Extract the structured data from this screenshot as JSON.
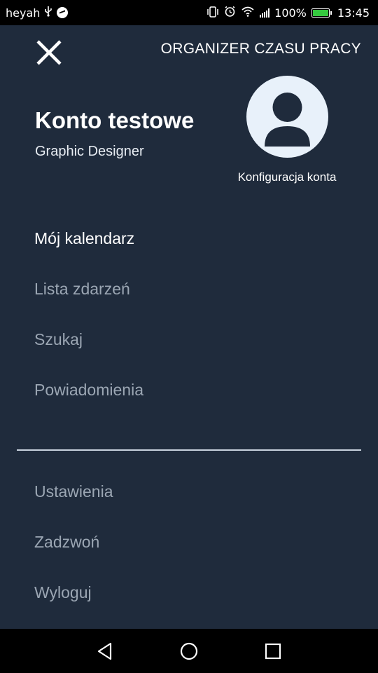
{
  "status_bar": {
    "carrier": "heyah",
    "battery_percent": "100%",
    "time": "13:45",
    "icons": [
      "usb-icon",
      "messenger-icon",
      "vibrate-icon",
      "alarm-icon",
      "wifi-icon",
      "signal-icon",
      "battery-icon"
    ]
  },
  "header": {
    "app_title": "ORGANIZER CZASU PRACY",
    "close_icon": "close-icon"
  },
  "profile": {
    "name": "Konto testowe",
    "role": "Graphic Designer",
    "account_config_label": "Konfiguracja konta",
    "avatar_icon": "user-avatar-icon"
  },
  "menu": {
    "primary": [
      {
        "label": "Mój kalendarz",
        "active": true
      },
      {
        "label": "Lista zdarzeń",
        "active": false
      },
      {
        "label": "Szukaj",
        "active": false
      },
      {
        "label": "Powiadomienia",
        "active": false
      }
    ],
    "secondary": [
      {
        "label": "Ustawienia"
      },
      {
        "label": "Zadzwoń"
      },
      {
        "label": "Wyloguj"
      }
    ]
  },
  "nav_bar": {
    "buttons": [
      "back-icon",
      "home-icon",
      "recents-icon"
    ]
  },
  "colors": {
    "background": "#1f2b3c",
    "active_text": "#ffffff",
    "inactive_text": "#9ba6b3",
    "avatar_bg": "#e8f1fa",
    "battery_green": "#35c93f"
  }
}
